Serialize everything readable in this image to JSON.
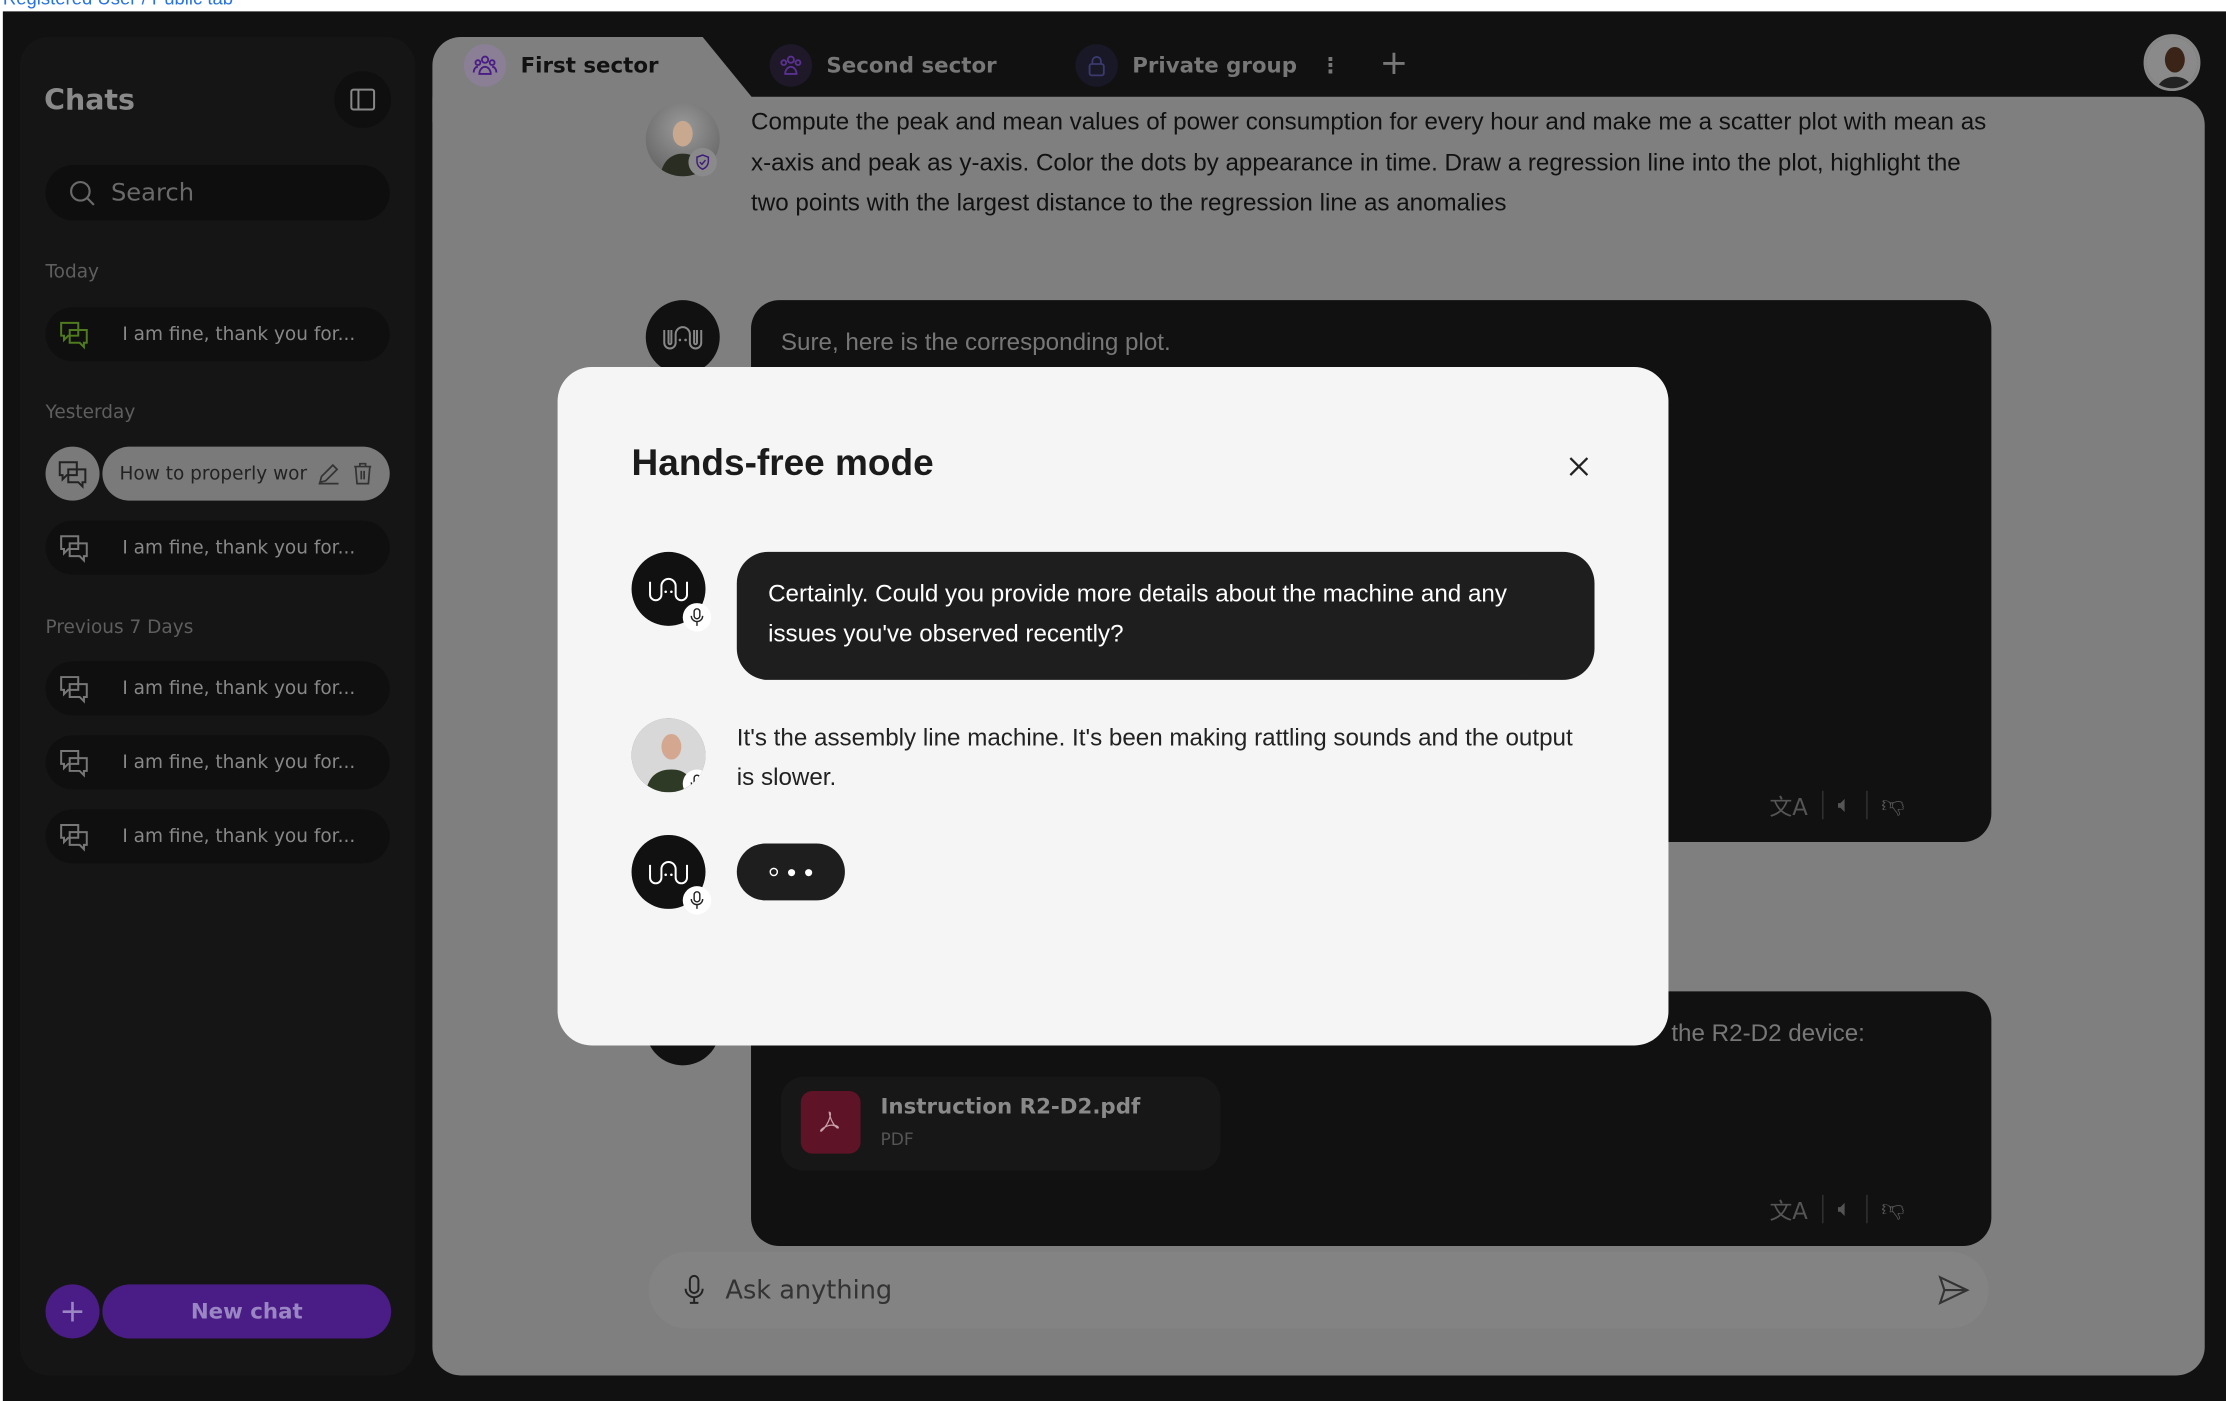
{
  "top_note": "Registered User / Public tab",
  "sidebar": {
    "title": "Chats",
    "search_placeholder": "Search",
    "sections": [
      {
        "label": "Today",
        "items": [
          {
            "label": "I am fine, thank you for..."
          }
        ]
      },
      {
        "label": "Yesterday",
        "items": [
          {
            "label": "How to properly wor",
            "selected": true
          },
          {
            "label": "I am fine, thank you for..."
          }
        ]
      },
      {
        "label": "Previous 7 Days",
        "items": [
          {
            "label": "I am fine, thank you for..."
          },
          {
            "label": "I am fine, thank you for..."
          },
          {
            "label": "I am fine, thank you for..."
          }
        ]
      }
    ],
    "new_chat_label": "New chat"
  },
  "tabs": [
    {
      "label": "First sector",
      "icon": "group-icon",
      "active": true
    },
    {
      "label": "Second sector",
      "icon": "group-icon"
    },
    {
      "label": "Private group",
      "icon": "lock-icon"
    }
  ],
  "conversation": {
    "user_message": "Compute the peak and mean values of power consumption for every hour and make me a scatter plot with mean as x-axis and peak as y-axis. Color the dots by appearance in time. Draw a regression line into the plot, highlight the two points with the largest distance to the regression line as anomalies",
    "bot_reply_1": "Sure, here is the corresponding plot.",
    "bot_reply_2_visible": "the R2-D2 device:",
    "attachment": {
      "name": "Instruction R2-D2.pdf",
      "type": "PDF"
    },
    "input_placeholder": "Ask anything"
  },
  "modal": {
    "title": "Hands-free mode",
    "messages": [
      {
        "role": "assistant",
        "text": "Certainly. Could you provide more details about the machine and any issues you've observed recently?"
      },
      {
        "role": "user",
        "text": "It's the assembly line machine. It's been making rattling sounds and the output is slower."
      },
      {
        "role": "assistant",
        "typing": true
      }
    ]
  },
  "colors": {
    "accent": "#6a2bc4",
    "pdf": "#c8203f",
    "modal_bg": "#f5f5f5"
  }
}
